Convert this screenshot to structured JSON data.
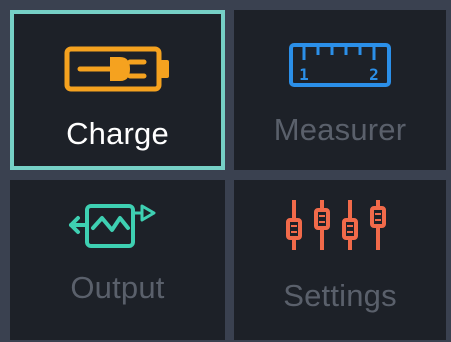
{
  "screen": {
    "background": "#3a4150",
    "tile_background": "#1d2128",
    "selected_border": "#76d0c6"
  },
  "tiles": [
    {
      "label": "Charge",
      "icon": "battery-plug-icon",
      "icon_color": "#f5a21f",
      "selected": true
    },
    {
      "label": "Measurer",
      "icon": "ruler-icon",
      "icon_color": "#2b8fe8",
      "selected": false
    },
    {
      "label": "Output",
      "icon": "output-signal-icon",
      "icon_color": "#3ed0b2",
      "selected": false
    },
    {
      "label": "Settings",
      "icon": "sliders-icon",
      "icon_color": "#f16a4a",
      "selected": false
    }
  ]
}
